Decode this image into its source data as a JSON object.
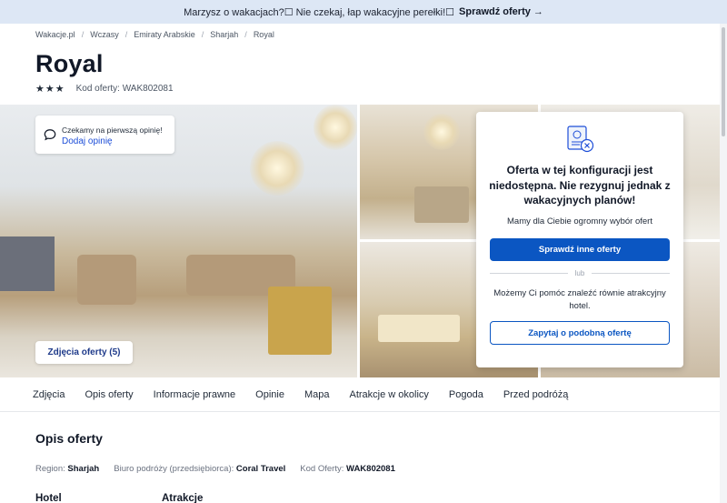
{
  "promo": {
    "text": "Marzysz o wakacjach?☐ Nie czekaj, łap wakacyjne perełki!☐",
    "cta": "Sprawdź oferty",
    "arrow": "→"
  },
  "breadcrumb": [
    "Wakacje.pl",
    "Wczasy",
    "Emiraty Arabskie",
    "Sharjah",
    "Royal"
  ],
  "hotel": {
    "name": "Royal",
    "stars": "★★★",
    "offer_code_label": "Kod oferty: WAK802081"
  },
  "review_card": {
    "text": "Czekamy na pierwszą opinię!",
    "link": "Dodaj opinię"
  },
  "gallery": {
    "photos_button": "Zdjęcia oferty (5)"
  },
  "offer_panel": {
    "heading": "Oferta w tej konfiguracji jest niedostępna. Nie rezygnuj jednak z wakacyjnych planów!",
    "sub": "Mamy dla Ciebie ogromny wybór ofert",
    "primary_button": "Sprawdź inne oferty",
    "or": "lub",
    "help": "Możemy Ci pomóc znaleźć równie atrakcyjny hotel.",
    "secondary_button": "Zapytaj o podobną ofertę"
  },
  "tabs": [
    "Zdjęcia",
    "Opis oferty",
    "Informacje prawne",
    "Opinie",
    "Mapa",
    "Atrakcje w okolicy",
    "Pogoda",
    "Przed podróżą"
  ],
  "description": {
    "title": "Opis oferty",
    "region_label": "Region:",
    "region_value": "Sharjah",
    "agency_label": "Biuro podróży (przedsiębiorca):",
    "agency_value": "Coral Travel",
    "code_label": "Kod Oferty:",
    "code_value": "WAK802081",
    "hotel_heading": "Hotel",
    "attractions_heading": "Atrakcje"
  },
  "colors": {
    "primary": "#0b56c2",
    "promo_bg": "#dde7f5"
  },
  "icons": {
    "review": "speech-bubble-icon",
    "offer_unavailable": "document-x-icon"
  }
}
